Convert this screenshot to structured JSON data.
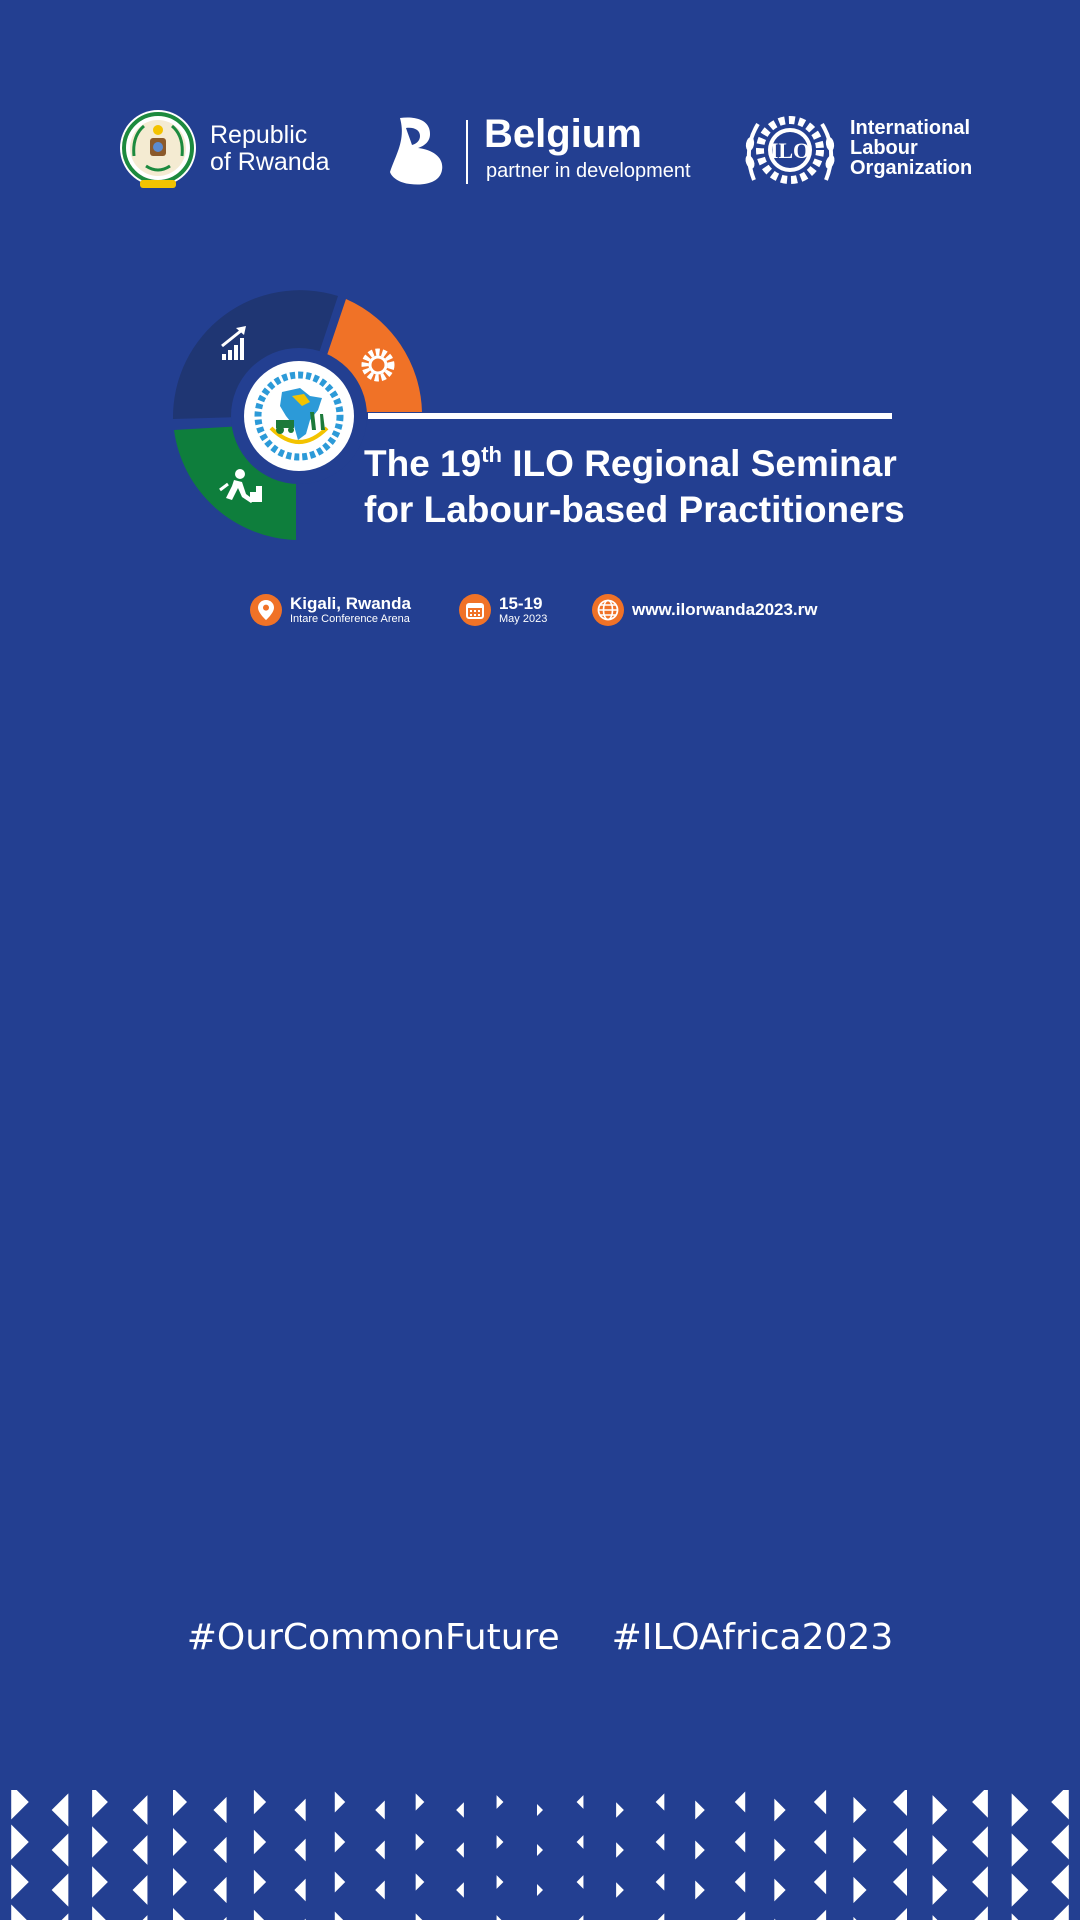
{
  "logos": {
    "rwanda": {
      "line1": "Republic",
      "line2": "of Rwanda"
    },
    "belgium": {
      "name": "Belgium",
      "tagline": "partner in development"
    },
    "ilo": {
      "line1": "International",
      "line2": "Labour",
      "line3": "Organization",
      "mark": "ILO"
    }
  },
  "seminar": {
    "title_prefix": "The 19",
    "title_ordinal": "th",
    "title_suffix": " ILO Regional Seminar",
    "title_line2": "for Labour-based Practitioners"
  },
  "info": {
    "location": {
      "icon": "location-pin-icon",
      "main": "Kigali, Rwanda",
      "sub": "Intare Conference Arena"
    },
    "date": {
      "icon": "calendar-icon",
      "main": "15-19",
      "sub": "May 2023"
    },
    "website": {
      "icon": "globe-icon",
      "url": "www.ilorwanda2023.rw"
    }
  },
  "hashtags": [
    "#OurCommonFuture",
    "#ILOAfrica2023"
  ],
  "colors": {
    "background": "#233F91",
    "dark_navy": "#1F3673",
    "orange": "#F07227",
    "green": "#0E7E3C",
    "white": "#FFFFFF"
  }
}
